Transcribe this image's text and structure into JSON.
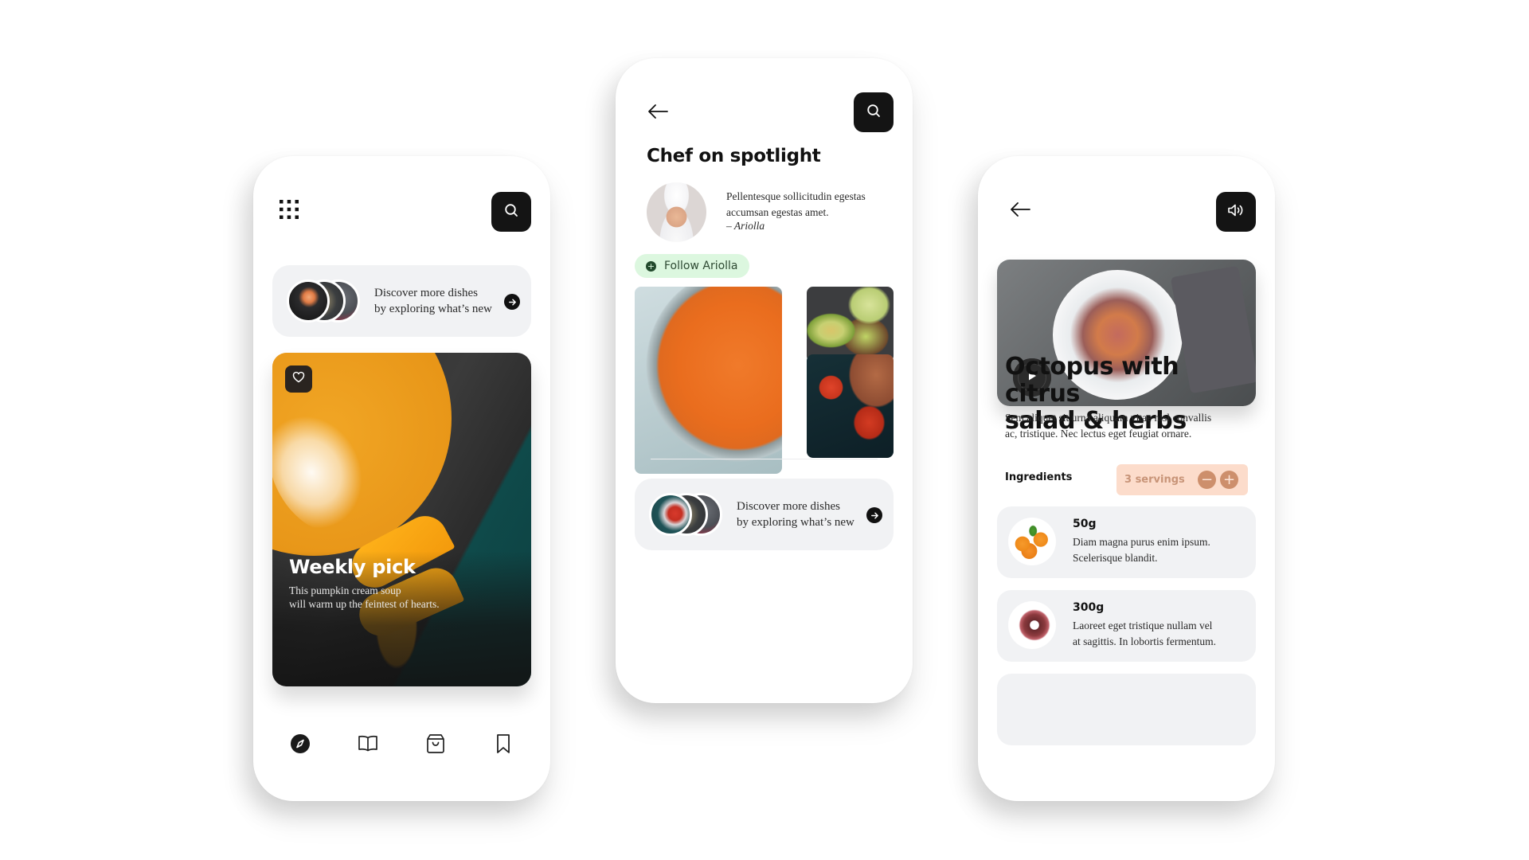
{
  "screens": {
    "home": {
      "menu_icon": "grid-menu-icon",
      "search_icon": "search-icon",
      "discover": {
        "line1": "Discover more dishes",
        "line2": "by exploring what’s new",
        "arrow_icon": "arrow-right-icon"
      },
      "weekly_pick": {
        "title": "Weekly pick",
        "line1": "This pumpkin cream soup",
        "line2": "will warm up the feintest of hearts.",
        "favorite_icon": "heart-icon"
      },
      "bottom_nav": [
        {
          "icon": "compass-icon",
          "active": true
        },
        {
          "icon": "book-icon",
          "active": false
        },
        {
          "icon": "shopping-bag-icon",
          "active": false
        },
        {
          "icon": "bookmark-icon",
          "active": false
        }
      ]
    },
    "chef": {
      "back_icon": "arrow-left-icon",
      "search_icon": "search-icon",
      "title": "Chef on spotlight",
      "quote_line1": "Pellentesque sollicitudin egestas",
      "quote_line2": "accumsan egestas amet.",
      "quote_author": "– Ariolla",
      "follow_label": "Follow Ariolla",
      "follow_icon": "plus-circle-icon",
      "discover": {
        "line1": "Discover more dishes",
        "line2": "by exploring what’s new",
        "arrow_icon": "arrow-right-icon"
      }
    },
    "recipe": {
      "back_icon": "arrow-left-icon",
      "sound_icon": "speaker-icon",
      "play_icon": "play-icon",
      "title_line1": "Octopus with citrus",
      "title_line2": "salad & herbs",
      "desc_line1": "Sem aliquet sit urna aliquam vitae nisl convallis",
      "desc_line2": "ac, tristique. Nec lectus eget feugiat ornare.",
      "ingredients_label": "Ingredients",
      "servings_label": "3 servings",
      "servings_count": 3,
      "minus_symbol": "−",
      "plus_symbol": "+",
      "ingredients": [
        {
          "amount": "50g",
          "line1": "Diam magna purus enim ipsum.",
          "line2": "Scelerisque blandit.",
          "image": "oranges"
        },
        {
          "amount": "300g",
          "line1": "Laoreet eget tristique nullam vel",
          "line2": "at sagittis. In lobortis fermentum.",
          "image": "octopus-tentacle"
        }
      ]
    }
  },
  "colors": {
    "dark_button": "#141414",
    "card_bg": "#f1f2f4",
    "follow_bg": "#dcf7df",
    "follow_text": "#2e4a33",
    "servings_bg": "#fcdccb",
    "servings_text": "#c89478",
    "servings_btn": "#cd8f6c"
  }
}
